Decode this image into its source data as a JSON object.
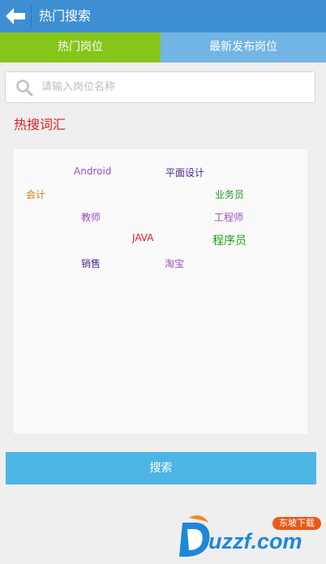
{
  "header": {
    "title": "热门搜索"
  },
  "tabs": [
    {
      "label": "热门岗位"
    },
    {
      "label": "最新发布岗位"
    }
  ],
  "search": {
    "placeholder": "请输入岗位名称",
    "value": ""
  },
  "section": {
    "title": "热搜词汇"
  },
  "keywords": [
    {
      "text": "Android",
      "color": "#9b4fbf"
    },
    {
      "text": "平面设计",
      "color": "#4d2a8a"
    },
    {
      "text": "会计",
      "color": "#d4761a"
    },
    {
      "text": "业务员",
      "color": "#1f9e1f"
    },
    {
      "text": "教师",
      "color": "#9b4fbf"
    },
    {
      "text": "工程师",
      "color": "#9b4fbf"
    },
    {
      "text": "JAVA",
      "color": "#c8262a"
    },
    {
      "text": "程序员",
      "color": "#1f9e1f"
    },
    {
      "text": "销售",
      "color": "#4d2a8a"
    },
    {
      "text": "淘宝",
      "color": "#9b4fbf"
    }
  ],
  "actions": {
    "search_label": "搜索"
  },
  "watermark": {
    "brand": "uzzf.com",
    "badge": "东坡下载"
  },
  "colors": {
    "header_bg": "#3e8fd1",
    "tab_active_bg": "#86c61a",
    "tab_inactive_bg": "#73b5e5",
    "section_title": "#e11d1d",
    "search_button_bg": "#4cb5e4"
  }
}
